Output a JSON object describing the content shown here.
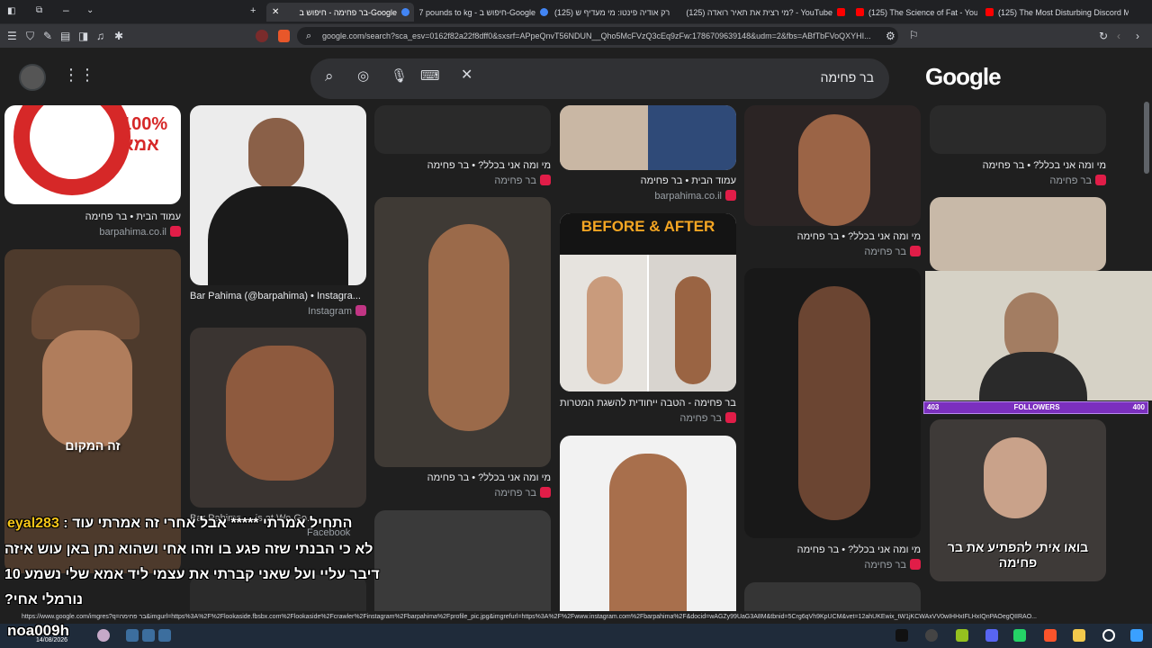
{
  "tabs": [
    {
      "label": "בר פחימה - חיפוש ב-Google",
      "active": true
    },
    {
      "label": "7 pounds to kg - חיפוש ב-Google"
    },
    {
      "label": "(125) לא רק אודיה פינטו: מי מעדיף ש"
    },
    {
      "label": "(125) מי רצית את תאיר רואדה? - YouTube"
    },
    {
      "label": "(125) The Science of Fat - YouTube"
    },
    {
      "label": "(125) The Most Disturbing Discord M"
    }
  ],
  "address": "google.com/search?sca_esv=0162f82a22f8dff0&sxsrf=APpeQnvT56NDUN__Qho5McFVzQ3cEq9zFw:1786709639148&udm=2&fbs=ABfTbFVoQXYHI...",
  "search": {
    "query": "בר פחימה",
    "logo": "Google"
  },
  "results": [
    {
      "title": "עמוד הבית • בר פחימה",
      "source": "barpahima.co.il"
    },
    {
      "title": "Bar Pahima (@barpahima) • Instagra...",
      "source": "Instagram"
    },
    {
      "title": "Bar Pahima ... is at We Go...",
      "source": "Facebook"
    },
    {
      "title": "מי ומה אני בכלל? • בר פחימה",
      "source": "בר פחימה"
    },
    {
      "title": "מי ומה אני בכלל? • בר פחימה",
      "source": "בר פחימה"
    },
    {
      "title": "עמוד הבית • בר פחימה",
      "source": "barpahima.co.il"
    },
    {
      "title": "בר פחימה - הטבה ייחודית להשגת המטרות...",
      "source": "בר פחימה"
    },
    {
      "title": "מי ומה אני בכלל? • בר פחימה",
      "source": "בר פחימה"
    },
    {
      "title": "מי ומה אני בכלל? • בר פחימה",
      "source": "בר פחימה"
    },
    {
      "title": "מי ומה אני בכלל? • בר פחימה",
      "source": "בר פחימה"
    }
  ],
  "logo_badge": "100% אמא",
  "before_after": "BEFORE & AFTER",
  "stream": {
    "followers_left": "403",
    "followers_label": "FOLLOWERS",
    "followers_right": "400",
    "cam_text": "בואו איתי להפתיע את בר פחימה",
    "overlay_caption": "זה המקום",
    "chat_user": "eyal283",
    "chat_lines": [
      "התחיל אמרתי ***** אבל אחרי זה אמרתי עוד",
      "לא כי הבנתי שזה פגע בו וזהו אחי ושהוא נתן באן עוש איזה",
      "10 דיבר עליי ועל שאני קברתי את עצמי ליד אמא שלי נשמע",
      "?נורמלי אחי"
    ],
    "streamer_tag": "noa009h"
  },
  "statusbar_url": "https://www.google.com/imgres?q=בר פחימה&imgurl=https%3A%2F%2Flookaside.fbsbx.com%2Flookaside%2Fcrawler%2Finstagram%2Fbarpahima%2Fprofile_pic.jpg&imgrefurl=https%3A%2F%2Fwww.instagram.com%2Fbarpahima%2F&docid=wAGZy99UaG3A8M&tbnid=5Crg6qVh9KpUCM&vet=12ahUKEwix_tW1jKCWAxVV0wIHHxIFLHxIQnPAOegQIIRAO...",
  "taskbar_date": "14/08/2026",
  "colors": {
    "bg": "#1f1f1f",
    "accent": "#8ab4f8",
    "followers_bar": "#7b2fbe"
  }
}
